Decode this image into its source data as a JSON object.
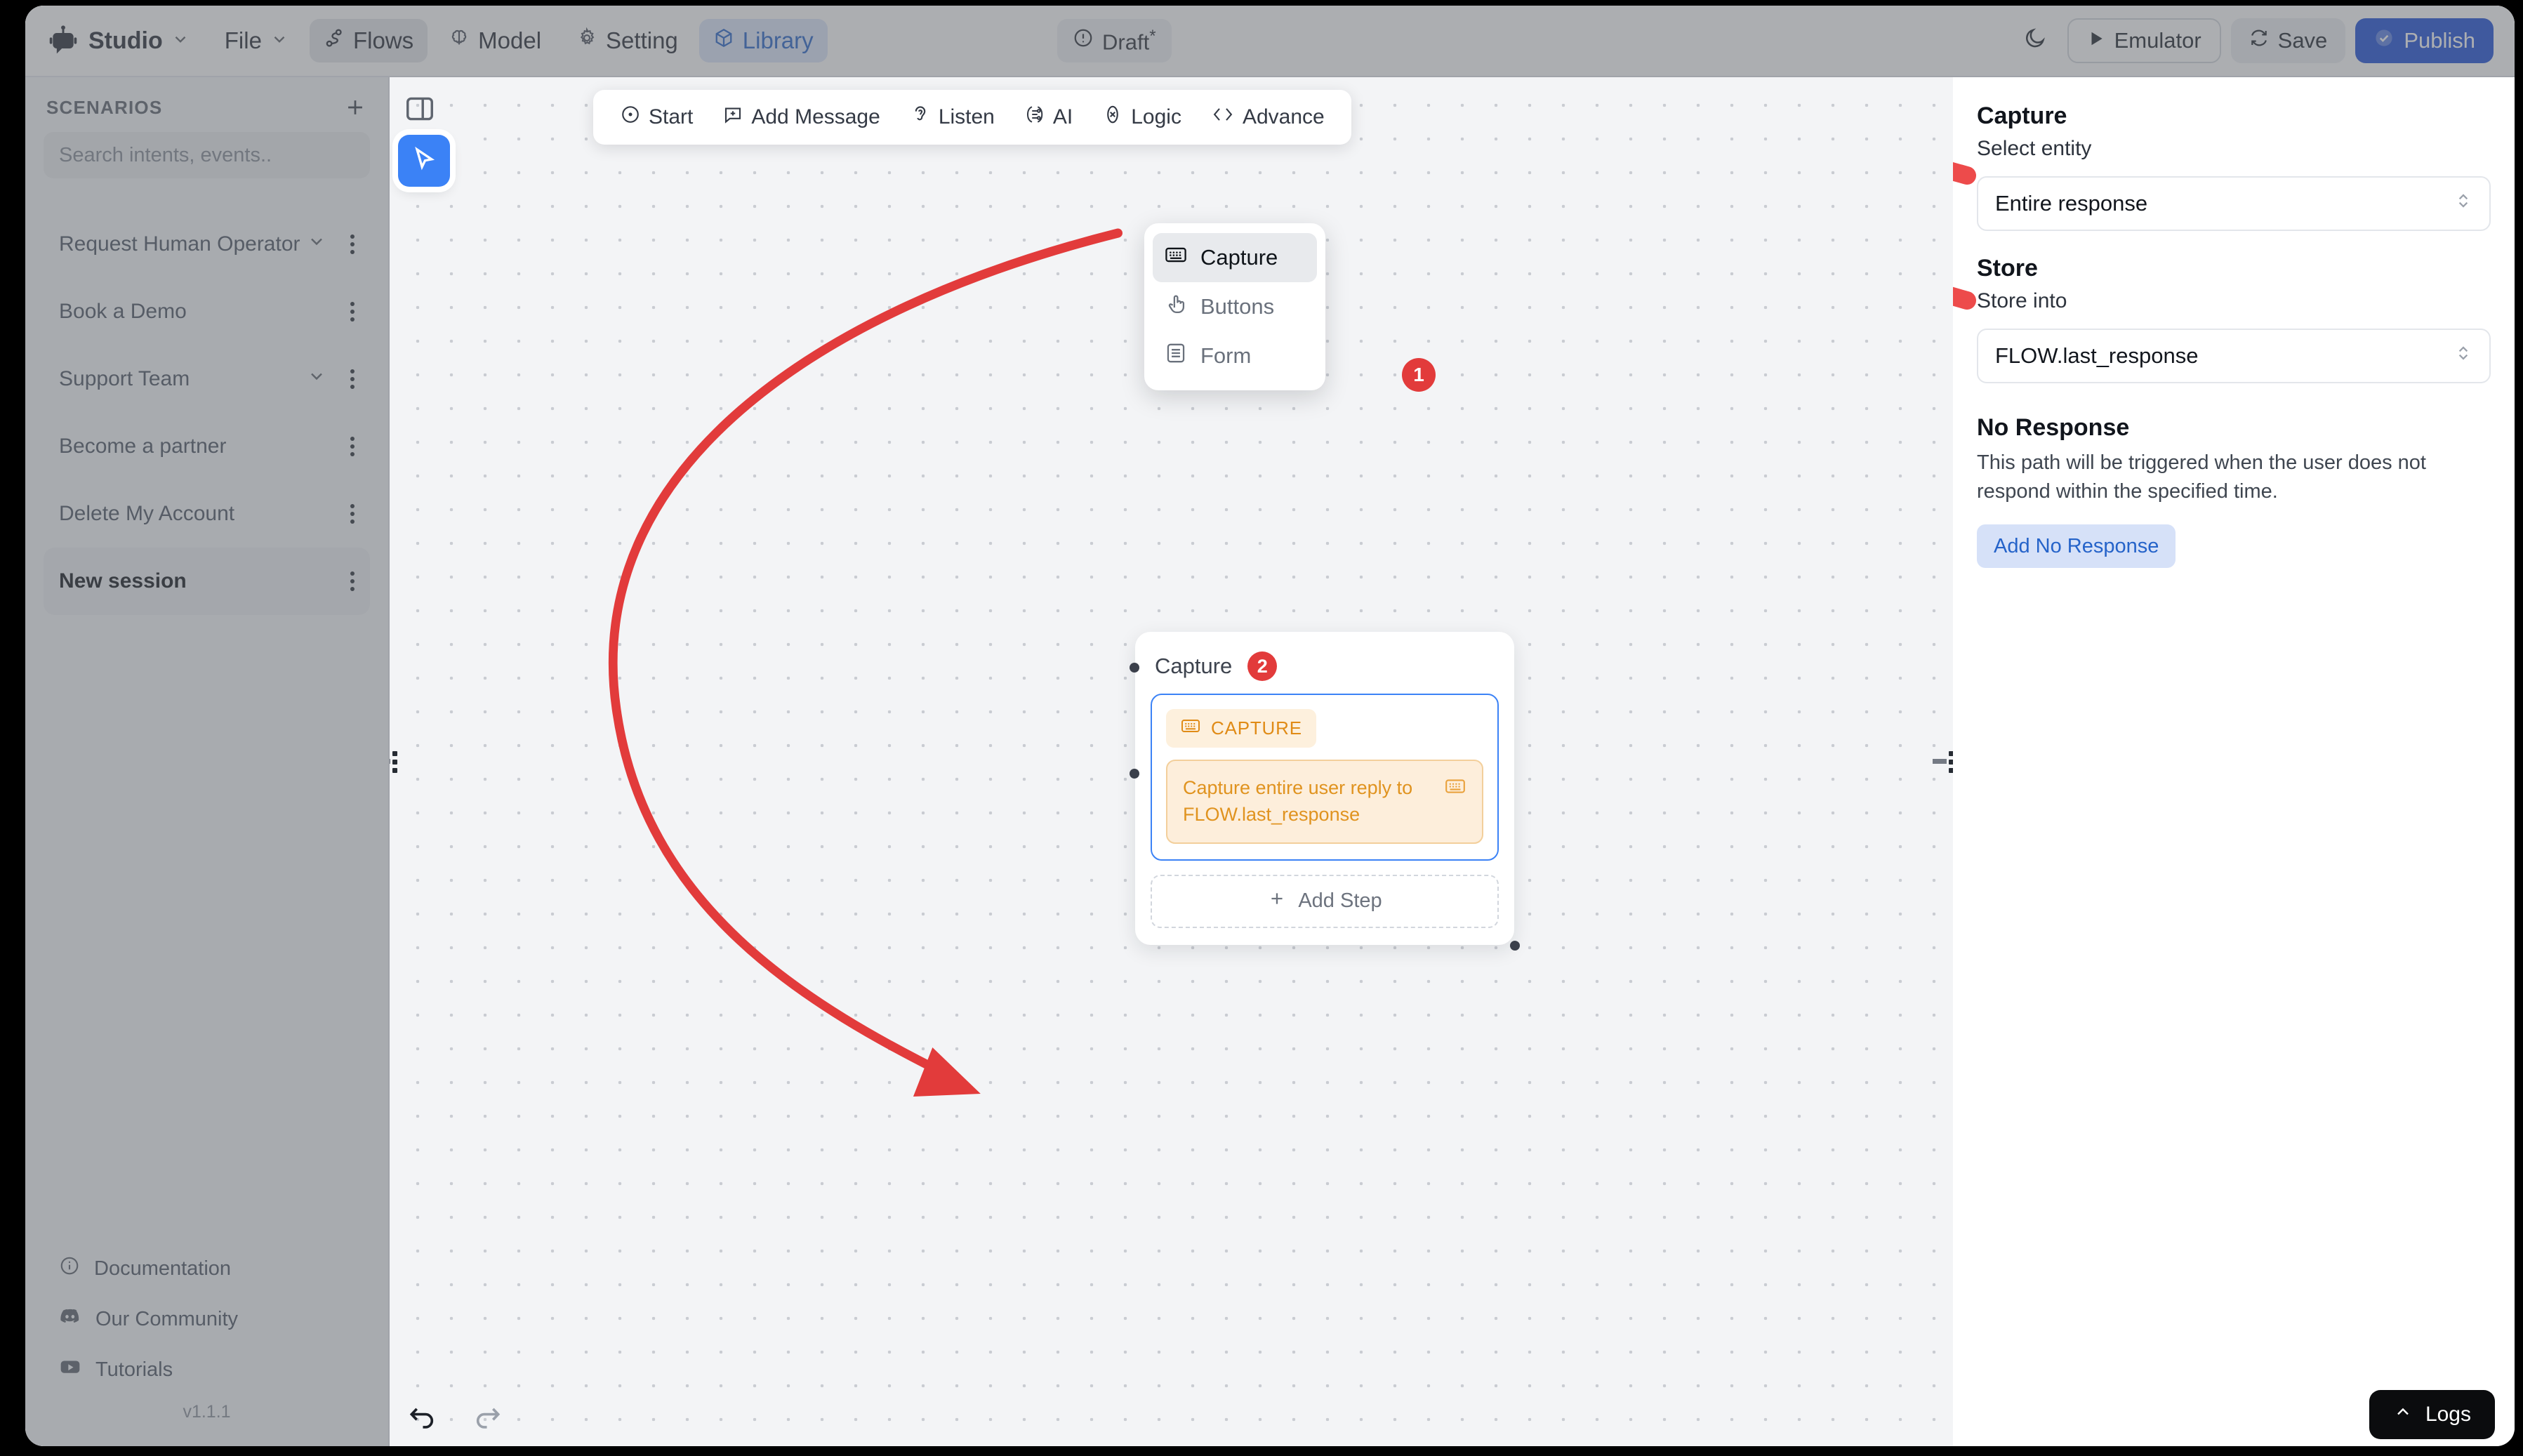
{
  "topbar": {
    "brand": "Studio",
    "menus": [
      {
        "label": "File",
        "icon": "chevron-down-icon",
        "state": "normal"
      },
      {
        "label": "Flows",
        "icon": "flows-icon",
        "state": "active-gray"
      },
      {
        "label": "Model",
        "icon": "brain-icon",
        "state": "normal"
      },
      {
        "label": "Setting",
        "icon": "gear-icon",
        "state": "normal"
      },
      {
        "label": "Library",
        "icon": "cube-icon",
        "state": "active-blue"
      }
    ],
    "status_chip": {
      "label": "Draft",
      "modified_marker": "*",
      "icon": "alert-circle-icon"
    },
    "actions": {
      "theme_toggle": "moon-icon",
      "emulator": "Emulator",
      "save": "Save",
      "publish": "Publish"
    },
    "accent_blue": "#1d4ed8"
  },
  "sidebar": {
    "section_title": "SCENARIOS",
    "add_label": "+",
    "search_placeholder": "Search intents, events..",
    "items": [
      {
        "label": "Request Human Operator",
        "expandable": true,
        "selected": false
      },
      {
        "label": "Book a Demo",
        "expandable": false,
        "selected": false
      },
      {
        "label": "Support Team",
        "expandable": true,
        "selected": false
      },
      {
        "label": "Become a partner",
        "expandable": false,
        "selected": false
      },
      {
        "label": "Delete My Account",
        "expandable": false,
        "selected": false
      },
      {
        "label": "New session",
        "expandable": false,
        "selected": true
      }
    ],
    "footer": [
      {
        "label": "Documentation",
        "icon": "info-circle-icon"
      },
      {
        "label": "Our Community",
        "icon": "discord-icon"
      },
      {
        "label": "Tutorials",
        "icon": "youtube-icon"
      }
    ],
    "version": "v1.1.1"
  },
  "canvas": {
    "toolbar": [
      {
        "label": "Start",
        "icon": "start-circle-icon"
      },
      {
        "label": "Add Message",
        "icon": "message-plus-icon"
      },
      {
        "label": "Listen",
        "icon": "ear-icon"
      },
      {
        "label": "AI",
        "icon": "ai-node-icon"
      },
      {
        "label": "Logic",
        "icon": "logic-x-icon"
      },
      {
        "label": "Advance",
        "icon": "code-brackets-icon"
      }
    ],
    "panel_toggle_icon": "panel-layout-icon",
    "cursor_tool_icon": "cursor-arrow-icon",
    "dropdown": {
      "items": [
        {
          "label": "Capture",
          "icon": "keyboard-icon",
          "active": true
        },
        {
          "label": "Buttons",
          "icon": "pointer-hand-icon",
          "active": false
        },
        {
          "label": "Form",
          "icon": "form-lines-icon",
          "active": false
        }
      ]
    },
    "node": {
      "title": "Capture",
      "badge": "2",
      "step_chip": {
        "label": "CAPTURE",
        "icon": "keyboard-icon"
      },
      "step_text": "Capture entire user reply to FLOW.last_response",
      "step_icon": "keyboard-icon",
      "add_step_label": "Add Step"
    },
    "annotation_badges": [
      {
        "number": "1"
      },
      {
        "number": "2"
      }
    ],
    "annotation_color": "#e23b3b",
    "undo_icon": "undo-arrow-icon",
    "redo_icon": "redo-arrow-icon"
  },
  "right_panel": {
    "title": "Capture",
    "entity_label": "Select entity",
    "entity_value": "Entire response",
    "store_heading": "Store",
    "store_label": "Store into",
    "store_value": "FLOW.last_response",
    "no_response_heading": "No Response",
    "no_response_desc": "This path will be triggered when the user does not respond within the specified time.",
    "add_no_response_label": "Add No Response"
  },
  "footer": {
    "logs_label": "Logs",
    "logs_icon": "chevron-up-icon"
  }
}
